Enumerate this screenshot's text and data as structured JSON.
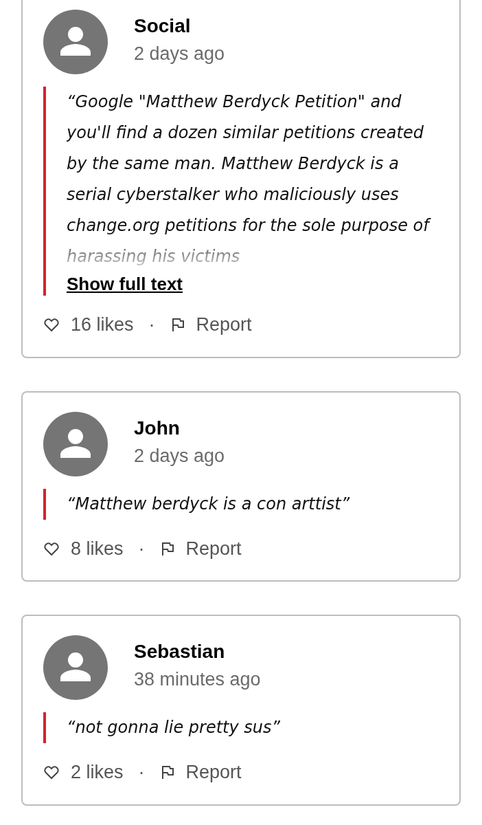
{
  "comments": [
    {
      "author": "Social",
      "time": "2 days ago",
      "text": "“Google \"Matthew Berdyck Petition\" and you'll find a dozen similar petitions created by the same man. Matthew Berdyck is a serial cyberstalker who maliciously uses change.org petitions for the sole purpose of harassing his victims",
      "truncated": true,
      "show_more": "Show full text",
      "likes": "16 likes",
      "separator": "·",
      "report": "Report"
    },
    {
      "author": "John",
      "time": "2 days ago",
      "text": "“Matthew berdyck is a con arttist”",
      "likes": "8 likes",
      "separator": "·",
      "report": "Report"
    },
    {
      "author": "Sebastian",
      "time": "38 minutes ago",
      "text": "“not gonna lie pretty sus”",
      "likes": "2 likes",
      "separator": "·",
      "report": "Report"
    }
  ]
}
